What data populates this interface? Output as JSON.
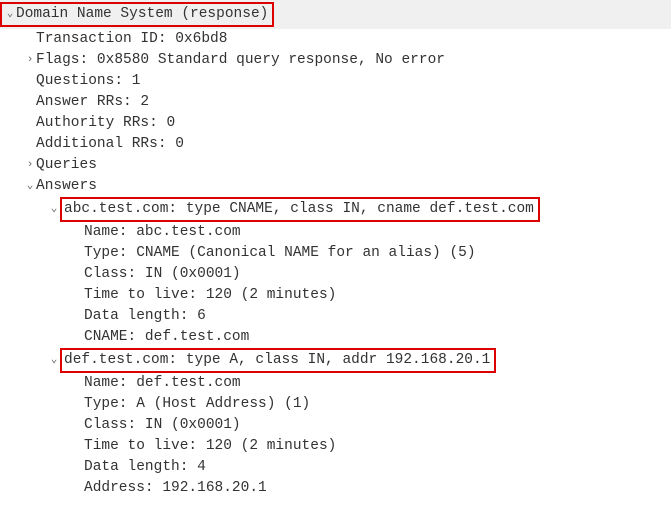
{
  "header": {
    "title": "Domain Name System (response)"
  },
  "fields": {
    "transaction_id": "Transaction ID: 0x6bd8",
    "flags": "Flags: 0x8580 Standard query response, No error",
    "questions": "Questions: 1",
    "answer_rrs": "Answer RRs: 2",
    "authority_rrs": "Authority RRs: 0",
    "additional_rrs": "Additional RRs: 0",
    "queries": "Queries",
    "answers": "Answers"
  },
  "answer1": {
    "summary": "abc.test.com: type CNAME, class IN, cname def.test.com",
    "name": "Name: abc.test.com",
    "type": "Type: CNAME (Canonical NAME for an alias) (5)",
    "class": "Class: IN (0x0001)",
    "ttl": "Time to live: 120 (2 minutes)",
    "datalen": "Data length: 6",
    "cname": "CNAME: def.test.com"
  },
  "answer2": {
    "summary": "def.test.com: type A, class IN, addr 192.168.20.1",
    "name": "Name: def.test.com",
    "type": "Type: A (Host Address) (1)",
    "class": "Class: IN (0x0001)",
    "ttl": "Time to live: 120 (2 minutes)",
    "datalen": "Data length: 4",
    "address": "Address: 192.168.20.1"
  }
}
